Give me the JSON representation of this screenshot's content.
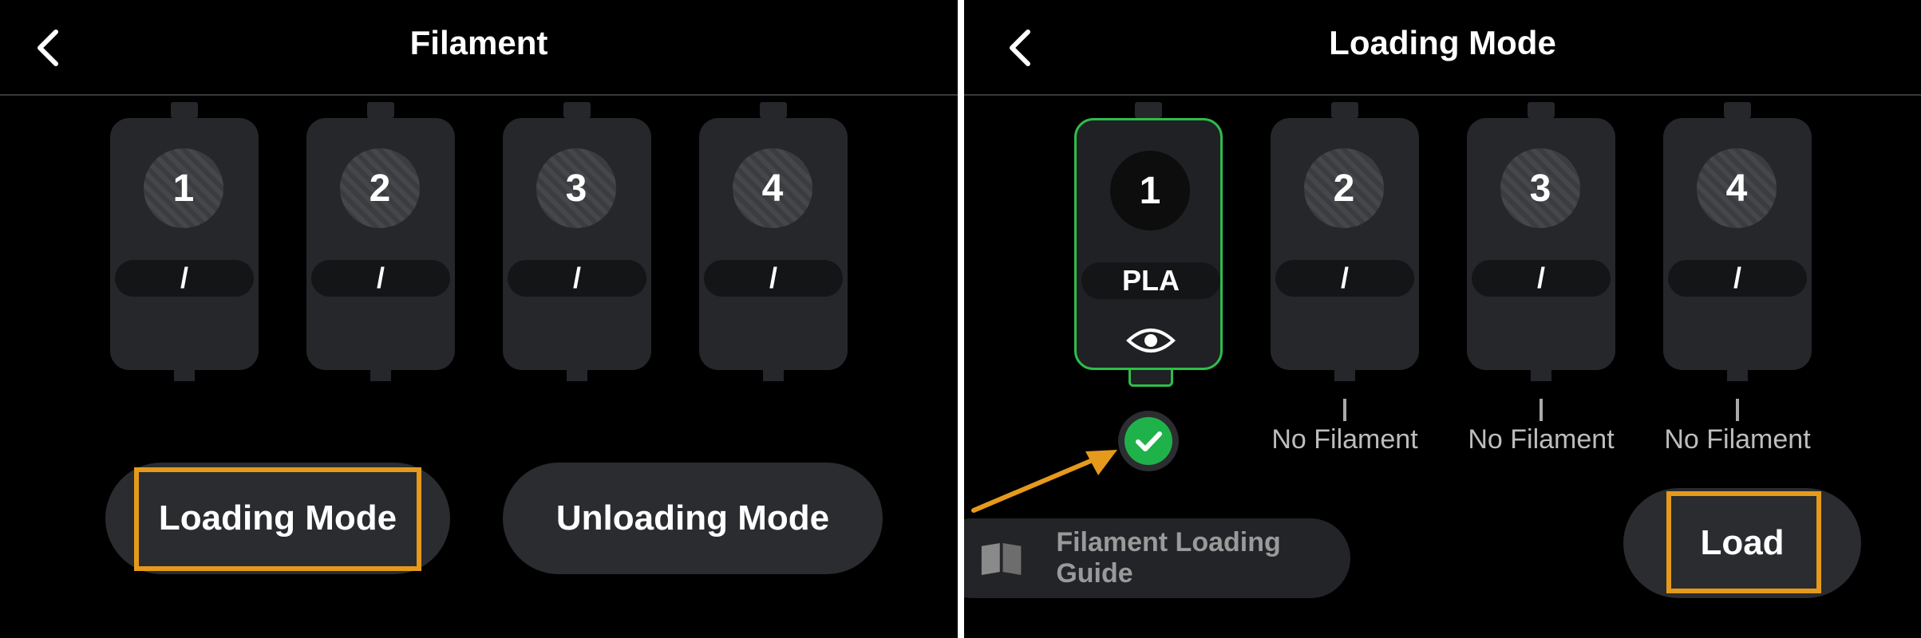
{
  "left": {
    "header": {
      "title": "Filament"
    },
    "slots": [
      {
        "number": "1",
        "material": "/"
      },
      {
        "number": "2",
        "material": "/"
      },
      {
        "number": "3",
        "material": "/"
      },
      {
        "number": "4",
        "material": "/"
      }
    ],
    "buttons": {
      "loading_mode": "Loading Mode",
      "unloading_mode": "Unloading Mode"
    }
  },
  "right": {
    "header": {
      "title": "Loading Mode"
    },
    "slots": [
      {
        "number": "1",
        "material": "PLA",
        "selected": true
      },
      {
        "number": "2",
        "material": "/",
        "status": "No Filament"
      },
      {
        "number": "3",
        "material": "/",
        "status": "No Filament"
      },
      {
        "number": "4",
        "material": "/",
        "status": "No Filament"
      }
    ],
    "guide_label": "Filament Loading Guide",
    "load_label": "Load"
  },
  "colors": {
    "accent_green": "#2ebd4a",
    "highlight_orange": "#e59a1c",
    "background": "#000000",
    "slot_body": "#25272a"
  }
}
